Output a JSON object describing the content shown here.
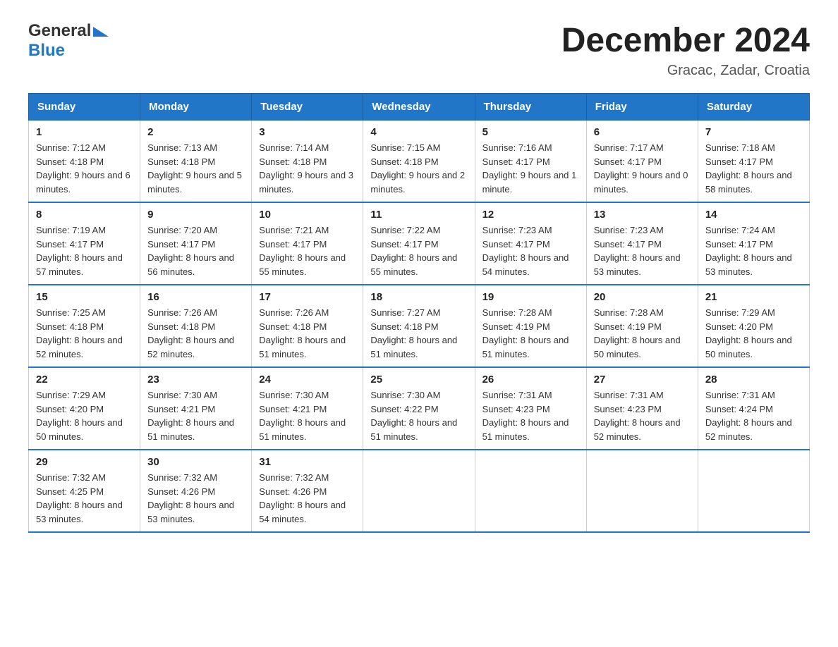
{
  "logo": {
    "general": "General",
    "blue": "Blue"
  },
  "title": "December 2024",
  "subtitle": "Gracac, Zadar, Croatia",
  "days_of_week": [
    "Sunday",
    "Monday",
    "Tuesday",
    "Wednesday",
    "Thursday",
    "Friday",
    "Saturday"
  ],
  "weeks": [
    [
      {
        "day": "1",
        "sunrise": "7:12 AM",
        "sunset": "4:18 PM",
        "daylight": "9 hours and 6 minutes."
      },
      {
        "day": "2",
        "sunrise": "7:13 AM",
        "sunset": "4:18 PM",
        "daylight": "9 hours and 5 minutes."
      },
      {
        "day": "3",
        "sunrise": "7:14 AM",
        "sunset": "4:18 PM",
        "daylight": "9 hours and 3 minutes."
      },
      {
        "day": "4",
        "sunrise": "7:15 AM",
        "sunset": "4:18 PM",
        "daylight": "9 hours and 2 minutes."
      },
      {
        "day": "5",
        "sunrise": "7:16 AM",
        "sunset": "4:17 PM",
        "daylight": "9 hours and 1 minute."
      },
      {
        "day": "6",
        "sunrise": "7:17 AM",
        "sunset": "4:17 PM",
        "daylight": "9 hours and 0 minutes."
      },
      {
        "day": "7",
        "sunrise": "7:18 AM",
        "sunset": "4:17 PM",
        "daylight": "8 hours and 58 minutes."
      }
    ],
    [
      {
        "day": "8",
        "sunrise": "7:19 AM",
        "sunset": "4:17 PM",
        "daylight": "8 hours and 57 minutes."
      },
      {
        "day": "9",
        "sunrise": "7:20 AM",
        "sunset": "4:17 PM",
        "daylight": "8 hours and 56 minutes."
      },
      {
        "day": "10",
        "sunrise": "7:21 AM",
        "sunset": "4:17 PM",
        "daylight": "8 hours and 55 minutes."
      },
      {
        "day": "11",
        "sunrise": "7:22 AM",
        "sunset": "4:17 PM",
        "daylight": "8 hours and 55 minutes."
      },
      {
        "day": "12",
        "sunrise": "7:23 AM",
        "sunset": "4:17 PM",
        "daylight": "8 hours and 54 minutes."
      },
      {
        "day": "13",
        "sunrise": "7:23 AM",
        "sunset": "4:17 PM",
        "daylight": "8 hours and 53 minutes."
      },
      {
        "day": "14",
        "sunrise": "7:24 AM",
        "sunset": "4:17 PM",
        "daylight": "8 hours and 53 minutes."
      }
    ],
    [
      {
        "day": "15",
        "sunrise": "7:25 AM",
        "sunset": "4:18 PM",
        "daylight": "8 hours and 52 minutes."
      },
      {
        "day": "16",
        "sunrise": "7:26 AM",
        "sunset": "4:18 PM",
        "daylight": "8 hours and 52 minutes."
      },
      {
        "day": "17",
        "sunrise": "7:26 AM",
        "sunset": "4:18 PM",
        "daylight": "8 hours and 51 minutes."
      },
      {
        "day": "18",
        "sunrise": "7:27 AM",
        "sunset": "4:18 PM",
        "daylight": "8 hours and 51 minutes."
      },
      {
        "day": "19",
        "sunrise": "7:28 AM",
        "sunset": "4:19 PM",
        "daylight": "8 hours and 51 minutes."
      },
      {
        "day": "20",
        "sunrise": "7:28 AM",
        "sunset": "4:19 PM",
        "daylight": "8 hours and 50 minutes."
      },
      {
        "day": "21",
        "sunrise": "7:29 AM",
        "sunset": "4:20 PM",
        "daylight": "8 hours and 50 minutes."
      }
    ],
    [
      {
        "day": "22",
        "sunrise": "7:29 AM",
        "sunset": "4:20 PM",
        "daylight": "8 hours and 50 minutes."
      },
      {
        "day": "23",
        "sunrise": "7:30 AM",
        "sunset": "4:21 PM",
        "daylight": "8 hours and 51 minutes."
      },
      {
        "day": "24",
        "sunrise": "7:30 AM",
        "sunset": "4:21 PM",
        "daylight": "8 hours and 51 minutes."
      },
      {
        "day": "25",
        "sunrise": "7:30 AM",
        "sunset": "4:22 PM",
        "daylight": "8 hours and 51 minutes."
      },
      {
        "day": "26",
        "sunrise": "7:31 AM",
        "sunset": "4:23 PM",
        "daylight": "8 hours and 51 minutes."
      },
      {
        "day": "27",
        "sunrise": "7:31 AM",
        "sunset": "4:23 PM",
        "daylight": "8 hours and 52 minutes."
      },
      {
        "day": "28",
        "sunrise": "7:31 AM",
        "sunset": "4:24 PM",
        "daylight": "8 hours and 52 minutes."
      }
    ],
    [
      {
        "day": "29",
        "sunrise": "7:32 AM",
        "sunset": "4:25 PM",
        "daylight": "8 hours and 53 minutes."
      },
      {
        "day": "30",
        "sunrise": "7:32 AM",
        "sunset": "4:26 PM",
        "daylight": "8 hours and 53 minutes."
      },
      {
        "day": "31",
        "sunrise": "7:32 AM",
        "sunset": "4:26 PM",
        "daylight": "8 hours and 54 minutes."
      },
      null,
      null,
      null,
      null
    ]
  ],
  "labels": {
    "sunrise": "Sunrise:",
    "sunset": "Sunset:",
    "daylight": "Daylight:"
  }
}
